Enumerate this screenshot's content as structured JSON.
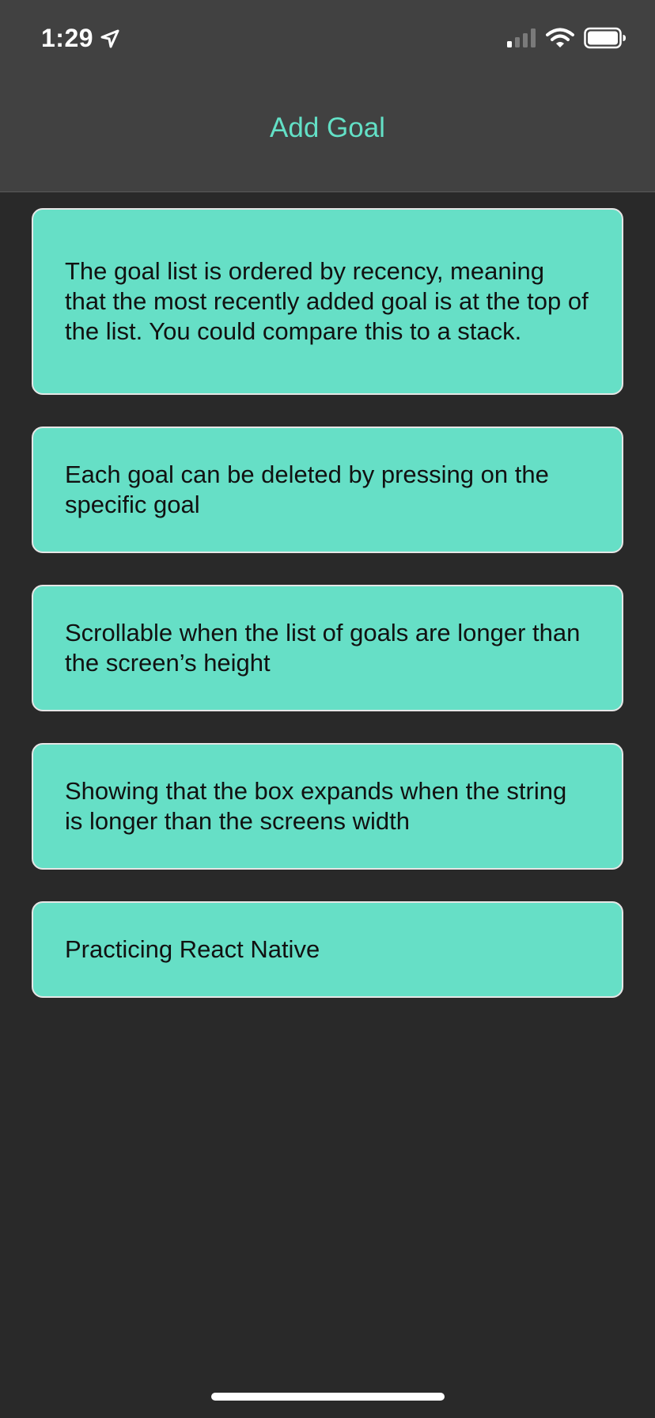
{
  "status_bar": {
    "time": "1:29",
    "location_icon": "location-arrow-icon",
    "signal_icon": "cellular-signal-icon",
    "wifi_icon": "wifi-icon",
    "battery_icon": "battery-icon"
  },
  "header": {
    "title": "Add Goal"
  },
  "goals": [
    {
      "text": "The goal list is ordered by recency, meaning that the most recently added goal is at the top of the list. You could compare this to a stack."
    },
    {
      "text": "Each goal can be deleted by pressing on the specific goal"
    },
    {
      "text": "Scrollable when the list of goals are longer than the screen’s height"
    },
    {
      "text": "Showing that the box expands when the string is longer than the screens width"
    },
    {
      "text": "Practicing React Native"
    }
  ],
  "colors": {
    "accent": "#63e0c6",
    "goal_background": "#66dfc6",
    "header_background": "#414141",
    "page_background": "#292929"
  }
}
